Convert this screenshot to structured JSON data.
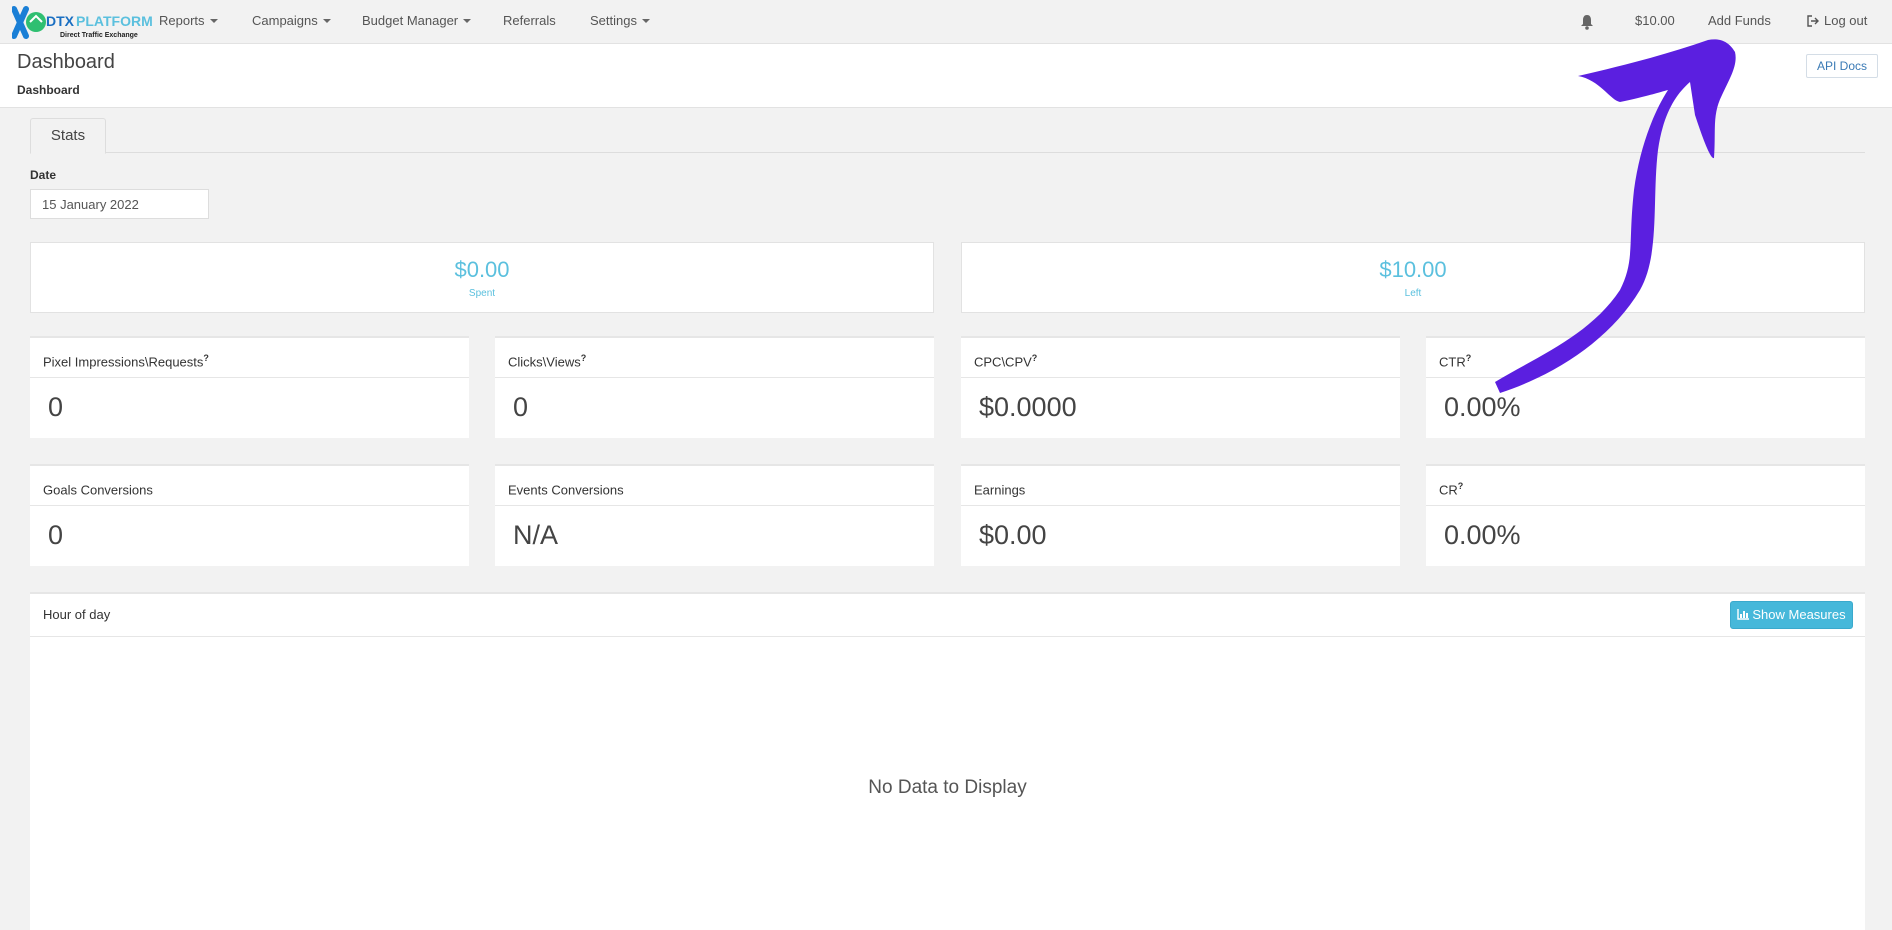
{
  "brand": {
    "name_prefix": "DTX",
    "name_suffix": "PLATFORM",
    "tagline": "Direct Traffic Exchange"
  },
  "nav": {
    "items": [
      {
        "label": "Reports"
      },
      {
        "label": "Campaigns"
      },
      {
        "label": "Budget Manager"
      },
      {
        "label": "Referrals"
      },
      {
        "label": "Settings"
      }
    ],
    "balance": "$10.00",
    "add_funds": "Add Funds",
    "logout": "Log out"
  },
  "header": {
    "title": "Dashboard",
    "breadcrumb": "Dashboard",
    "api_docs": "API Docs"
  },
  "tabs": [
    {
      "label": "Stats"
    }
  ],
  "date": {
    "label": "Date",
    "value": "15 January 2022"
  },
  "summary": [
    {
      "value": "$0.00",
      "label": "Spent"
    },
    {
      "value": "$10.00",
      "label": "Left"
    }
  ],
  "metrics": [
    {
      "label": "Pixel Impressions\\Requests",
      "hint": "?",
      "value": "0"
    },
    {
      "label": "Clicks\\Views",
      "hint": "?",
      "value": "0"
    },
    {
      "label": "CPC\\CPV",
      "hint": "?",
      "value": "$0.0000"
    },
    {
      "label": "CTR",
      "hint": "?",
      "value": "0.00%"
    },
    {
      "label": "Goals Conversions",
      "hint": "",
      "value": "0"
    },
    {
      "label": "Events Conversions",
      "hint": "",
      "value": "N/A"
    },
    {
      "label": "Earnings",
      "hint": "",
      "value": "$0.00"
    },
    {
      "label": "CR",
      "hint": "?",
      "value": "0.00%"
    }
  ],
  "hour_of_day": {
    "title": "Hour of day",
    "button": "Show Measures",
    "empty": "No Data to Display"
  },
  "colors": {
    "accent": "#5bc0de",
    "button": "#46b8da",
    "annotation_arrow": "#5b1fe0"
  }
}
